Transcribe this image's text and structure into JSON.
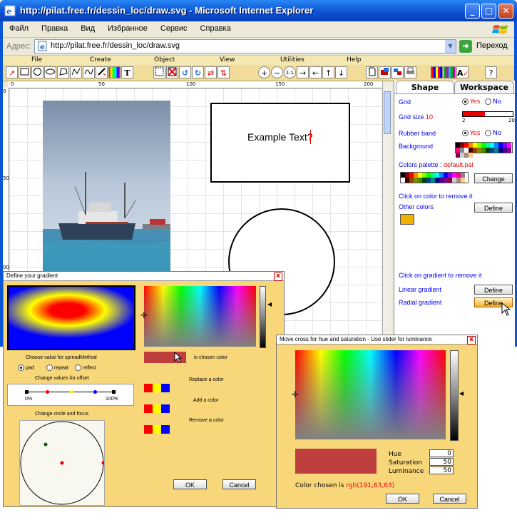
{
  "window": {
    "title": "http://pilat.free.fr/dessin_loc/draw.svg - Microsoft Internet Explorer",
    "minimize": "_",
    "maximize": "□",
    "close": "✕"
  },
  "menu": [
    "Файл",
    "Правка",
    "Вид",
    "Избранное",
    "Сервис",
    "Справка"
  ],
  "address": {
    "label": "Адрес:",
    "url": "http://pilat.free.fr/dessin_loc/draw.svg",
    "go_label": "Переход"
  },
  "toolbar": {
    "categories": [
      "File",
      "Create",
      "Object",
      "View",
      "Utilities",
      "Help"
    ],
    "help_button": "?",
    "text_tool": "T",
    "pan_keys": [
      "→",
      "←",
      "↑",
      "↓"
    ]
  },
  "ruler": {
    "top_marks": [
      "0",
      "50",
      "100",
      "150",
      "200"
    ],
    "left_marks": [
      "0",
      "50",
      "00"
    ]
  },
  "canvas": {
    "example_text": "Example Text?"
  },
  "panel": {
    "tabs": [
      "Shape",
      "Workspace"
    ],
    "grid_label": "Grid",
    "grid_yes": "Yes",
    "grid_no": "No",
    "grid_size_label": "Grid size",
    "grid_size_value": "10",
    "grid_slider": {
      "min": "2",
      "max": "20",
      "value": 10
    },
    "rubber_band_label": "Rubber band",
    "rubber_yes": "Yes",
    "rubber_no": "No",
    "background_label": "Background",
    "colors_palette_label": "Colors palette :",
    "colors_palette_file": "default.pal",
    "change_button": "Change",
    "click_color_remove": "Click on color to remove it",
    "other_colors_label": "Other colors",
    "define_button": "Define",
    "other_color_swatch": "#f0b000",
    "click_gradient_remove": "Click on gradient to remove it",
    "linear_gradient_label": "Linear gradient",
    "radial_gradient_label": "Radial gradient",
    "linear_define": "Define",
    "radial_define": "Define"
  },
  "gradient_dialog": {
    "title": "Define your gradient",
    "close": "x",
    "chosen_color_label": "is chosen color",
    "chosen_color": "#bf3f3f",
    "spread_method_label": "Choose value for spreadMethod",
    "spread_options": [
      "pad",
      "repeat",
      "reflect"
    ],
    "spread_selected": "pad",
    "offset_label": "Change values for offset",
    "offset_min": "0%",
    "offset_max": "100%",
    "circle_label": "Change circle and focus",
    "replace_color": "Replace a color",
    "add_color": "Add a color",
    "remove_color": "Remove a color",
    "ok": "OK",
    "cancel": "Cancel"
  },
  "hue_dialog": {
    "title": "Move cross for hue and saturation - Use slider for luminance",
    "close": "x",
    "hue_label": "Hue",
    "hue_value": "0",
    "saturation_label": "Saturation",
    "saturation_value": "50",
    "luminance_label": "Luminance",
    "luminance_value": "50",
    "color_chosen_prefix": "Color chosen is",
    "color_chosen_value": "rgb(191,63,63)",
    "chosen_color": "#bf3f3f",
    "ok": "OK",
    "cancel": "Cancel"
  },
  "colors": {
    "title_bar": "#0a4fd1",
    "toolbar_bg": "#f1dc9a",
    "dialog_bg": "#f8d77a",
    "label_blue": "#0000ff",
    "accent_red": "#ff0000"
  }
}
